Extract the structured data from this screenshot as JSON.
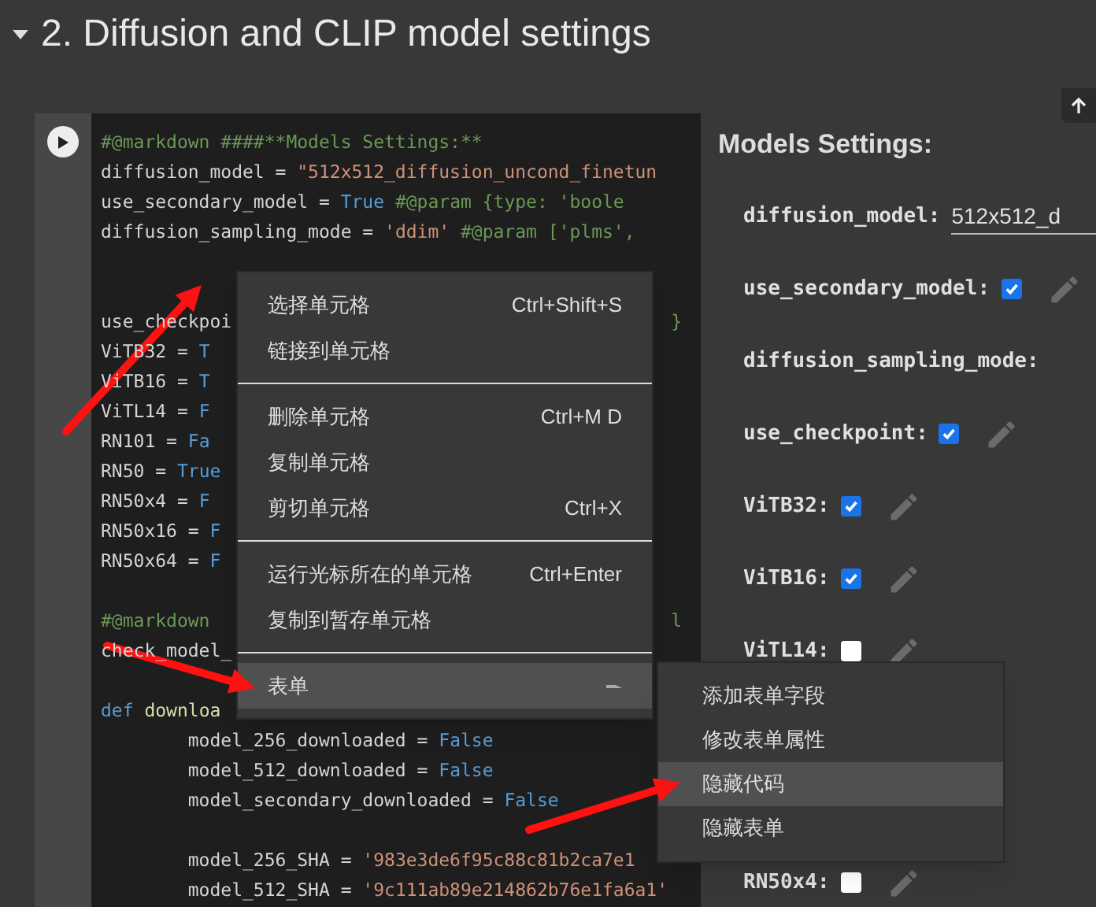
{
  "section": {
    "title": "2. Diffusion and CLIP model settings",
    "expanded": true
  },
  "code_lines": [
    {
      "tokens": [
        {
          "text": "#@markdown ####**Models Settings:**",
          "kind": "comment"
        }
      ]
    },
    {
      "tokens": [
        {
          "text": "diffusion_model = ",
          "kind": "plain"
        },
        {
          "text": "\"512x512_diffusion_uncond_finetun",
          "kind": "string"
        }
      ]
    },
    {
      "tokens": [
        {
          "text": "use_secondary_model = ",
          "kind": "plain"
        },
        {
          "text": "True",
          "kind": "keyword"
        },
        {
          "text": " #@param {type: 'boole",
          "kind": "comment"
        }
      ]
    },
    {
      "tokens": [
        {
          "text": "diffusion_sampling_mode = ",
          "kind": "plain"
        },
        {
          "text": "'ddim'",
          "kind": "string"
        },
        {
          "text": " #@param ['plms',",
          "kind": "comment"
        }
      ]
    },
    {
      "kind": "blank"
    },
    {
      "kind": "blank"
    },
    {
      "tokens": [
        {
          "text": "use_checkpoi",
          "kind": "plain"
        }
      ],
      "tail": {
        "text": "}",
        "kind": "comment"
      }
    },
    {
      "tokens": [
        {
          "text": "ViTB32 = ",
          "kind": "plain"
        },
        {
          "text": "T",
          "kind": "keyword"
        }
      ]
    },
    {
      "tokens": [
        {
          "text": "ViTB16 = ",
          "kind": "plain"
        },
        {
          "text": "T",
          "kind": "keyword"
        }
      ]
    },
    {
      "tokens": [
        {
          "text": "ViTL14 = ",
          "kind": "plain"
        },
        {
          "text": "F",
          "kind": "keyword"
        }
      ]
    },
    {
      "tokens": [
        {
          "text": "RN101 = ",
          "kind": "plain"
        },
        {
          "text": "Fa",
          "kind": "keyword"
        }
      ]
    },
    {
      "tokens": [
        {
          "text": "RN50 = ",
          "kind": "plain"
        },
        {
          "text": "True",
          "kind": "keyword"
        }
      ]
    },
    {
      "tokens": [
        {
          "text": "RN50x4 = ",
          "kind": "plain"
        },
        {
          "text": "F",
          "kind": "keyword"
        }
      ]
    },
    {
      "tokens": [
        {
          "text": "RN50x16 = ",
          "kind": "plain"
        },
        {
          "text": "F",
          "kind": "keyword"
        }
      ]
    },
    {
      "tokens": [
        {
          "text": "RN50x64 = ",
          "kind": "plain"
        },
        {
          "text": "F",
          "kind": "keyword"
        }
      ]
    },
    {
      "kind": "blank"
    },
    {
      "tokens": [
        {
          "text": "#@markdown",
          "kind": "comment"
        }
      ],
      "tail": {
        "text": "l",
        "kind": "comment"
      }
    },
    {
      "tokens": [
        {
          "text": "check_model_",
          "kind": "plain"
        }
      ]
    },
    {
      "kind": "blank"
    },
    {
      "tokens": [
        {
          "text": "def ",
          "kind": "keyword"
        },
        {
          "text": "downloa",
          "kind": "function"
        }
      ]
    },
    {
      "tokens": [
        {
          "text": "        model_256_downloaded = ",
          "kind": "plain"
        },
        {
          "text": "False",
          "kind": "keyword"
        }
      ]
    },
    {
      "tokens": [
        {
          "text": "        model_512_downloaded = ",
          "kind": "plain"
        },
        {
          "text": "False",
          "kind": "keyword"
        }
      ]
    },
    {
      "tokens": [
        {
          "text": "        model_secondary_downloaded = ",
          "kind": "plain"
        },
        {
          "text": "False",
          "kind": "keyword"
        }
      ]
    },
    {
      "kind": "blank"
    },
    {
      "tokens": [
        {
          "text": "        model_256_SHA = ",
          "kind": "plain"
        },
        {
          "text": "'983e3de6f95c88c81b2ca7e1",
          "kind": "string"
        }
      ]
    },
    {
      "tokens": [
        {
          "text": "        model_512_SHA = ",
          "kind": "plain"
        },
        {
          "text": "'9c111ab89e214862b76e1fa6a1'",
          "kind": "string"
        }
      ]
    }
  ],
  "form": {
    "title": "Models Settings:",
    "fields": [
      {
        "label": "diffusion_model:",
        "kind": "text",
        "value": "512x512_d"
      },
      {
        "label": "use_secondary_model:",
        "kind": "checkbox",
        "checked": true
      },
      {
        "label": "diffusion_sampling_mode:",
        "kind": "label"
      },
      {
        "label": "use_checkpoint:",
        "kind": "checkbox",
        "checked": true
      },
      {
        "label": "ViTB32:",
        "kind": "checkbox",
        "checked": true
      },
      {
        "label": "ViTB16:",
        "kind": "checkbox",
        "checked": true
      },
      {
        "label": "ViTL14:",
        "kind": "checkbox",
        "checked": false
      },
      {
        "label": "RN50x4:",
        "kind": "checkbox",
        "checked": false
      }
    ]
  },
  "context_menu": [
    {
      "kind": "item",
      "label": "选择单元格",
      "shortcut": "Ctrl+Shift+S",
      "selected": false
    },
    {
      "kind": "item",
      "label": "链接到单元格",
      "selected": false
    },
    {
      "kind": "separator"
    },
    {
      "kind": "item",
      "label": "删除单元格",
      "shortcut": "Ctrl+M D",
      "selected": false
    },
    {
      "kind": "item",
      "label": "复制单元格",
      "selected": false
    },
    {
      "kind": "item",
      "label": "剪切单元格",
      "shortcut": "Ctrl+X",
      "selected": false
    },
    {
      "kind": "separator"
    },
    {
      "kind": "item",
      "label": "运行光标所在的单元格",
      "shortcut": "Ctrl+Enter",
      "selected": false
    },
    {
      "kind": "item",
      "label": "复制到暂存单元格",
      "selected": false
    },
    {
      "kind": "separator"
    },
    {
      "kind": "submenu",
      "label": "表单",
      "selected": true
    }
  ],
  "submenu": [
    {
      "label": "添加表单字段",
      "selected": false
    },
    {
      "label": "修改表单属性",
      "selected": false
    },
    {
      "label": "隐藏代码",
      "selected": true
    },
    {
      "label": "隐藏表单",
      "selected": false
    }
  ]
}
